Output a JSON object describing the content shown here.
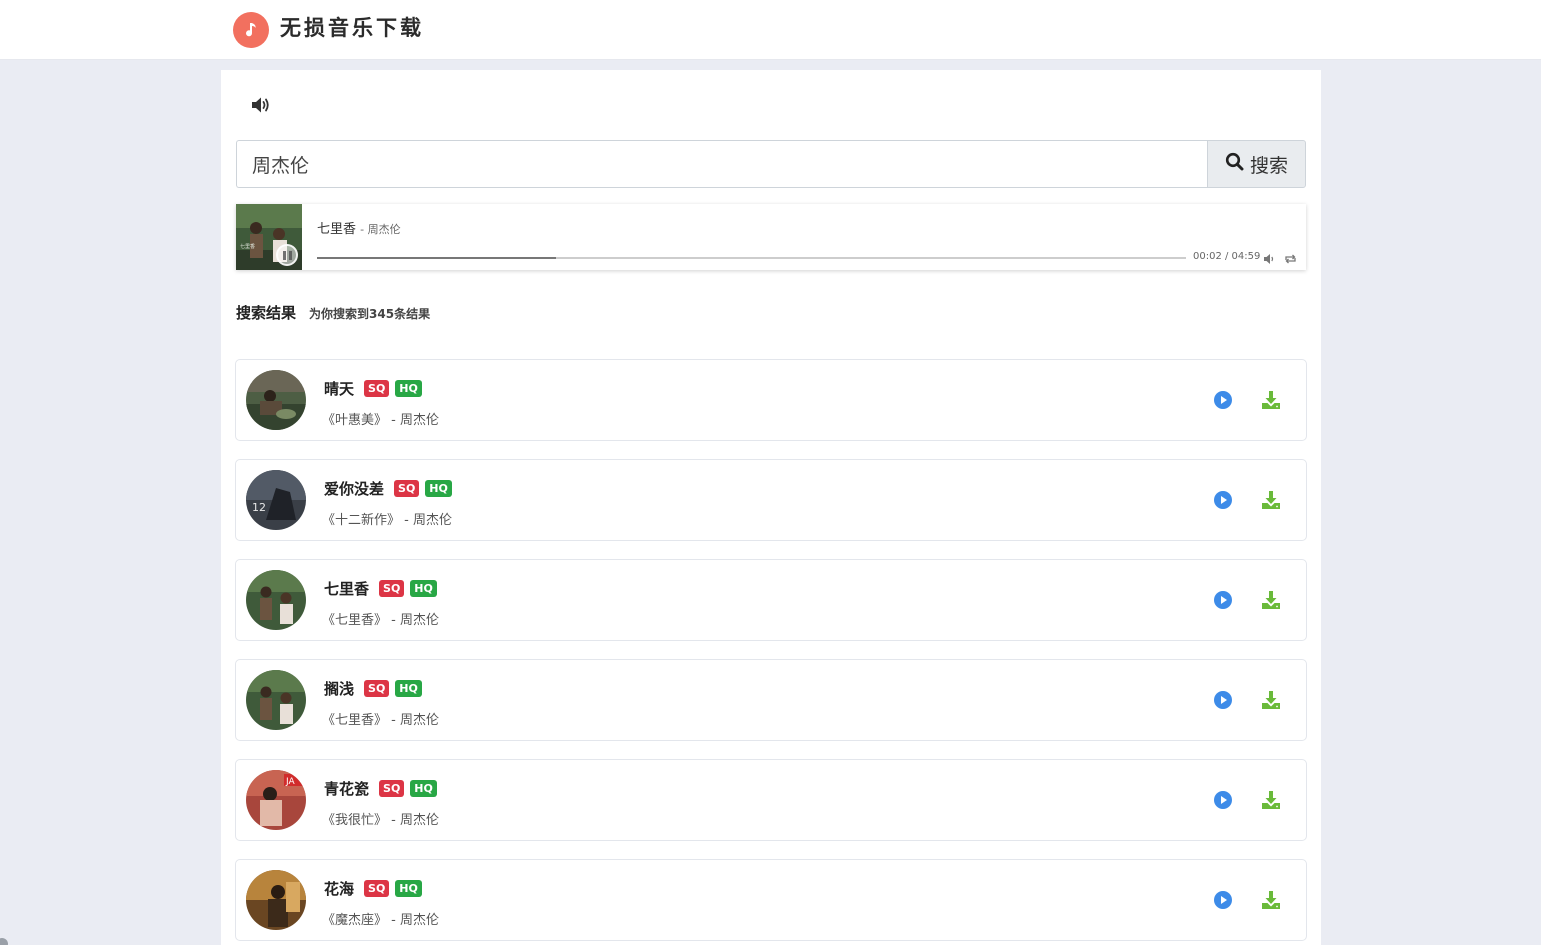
{
  "header": {
    "site_title": "无损音乐下载",
    "logo_icon": "music-note-icon",
    "brand_color": "#f2705f"
  },
  "search": {
    "query": "周杰伦",
    "button_label": "搜索"
  },
  "player": {
    "title": "七里香",
    "artist": "- 周杰伦",
    "time": "00:02 / 04:59",
    "progress": 0.275
  },
  "results": {
    "title": "搜索结果",
    "count_text": "为你搜索到345条结果",
    "badges": {
      "sq": "SQ",
      "hq": "HQ"
    },
    "songs": [
      {
        "name": "晴天",
        "meta": "《叶惠美》 - 周杰伦"
      },
      {
        "name": "爱你没差",
        "meta": "《十二新作》 - 周杰伦"
      },
      {
        "name": "七里香",
        "meta": "《七里香》 - 周杰伦"
      },
      {
        "name": "搁浅",
        "meta": "《七里香》 - 周杰伦"
      },
      {
        "name": "青花瓷",
        "meta": "《我很忙》 - 周杰伦"
      },
      {
        "name": "花海",
        "meta": "《魔杰座》 - 周杰伦"
      }
    ]
  },
  "colors": {
    "play": "#3d8be8",
    "download": "#6aba3a",
    "sq": "#dc3545",
    "hq": "#28a745"
  }
}
